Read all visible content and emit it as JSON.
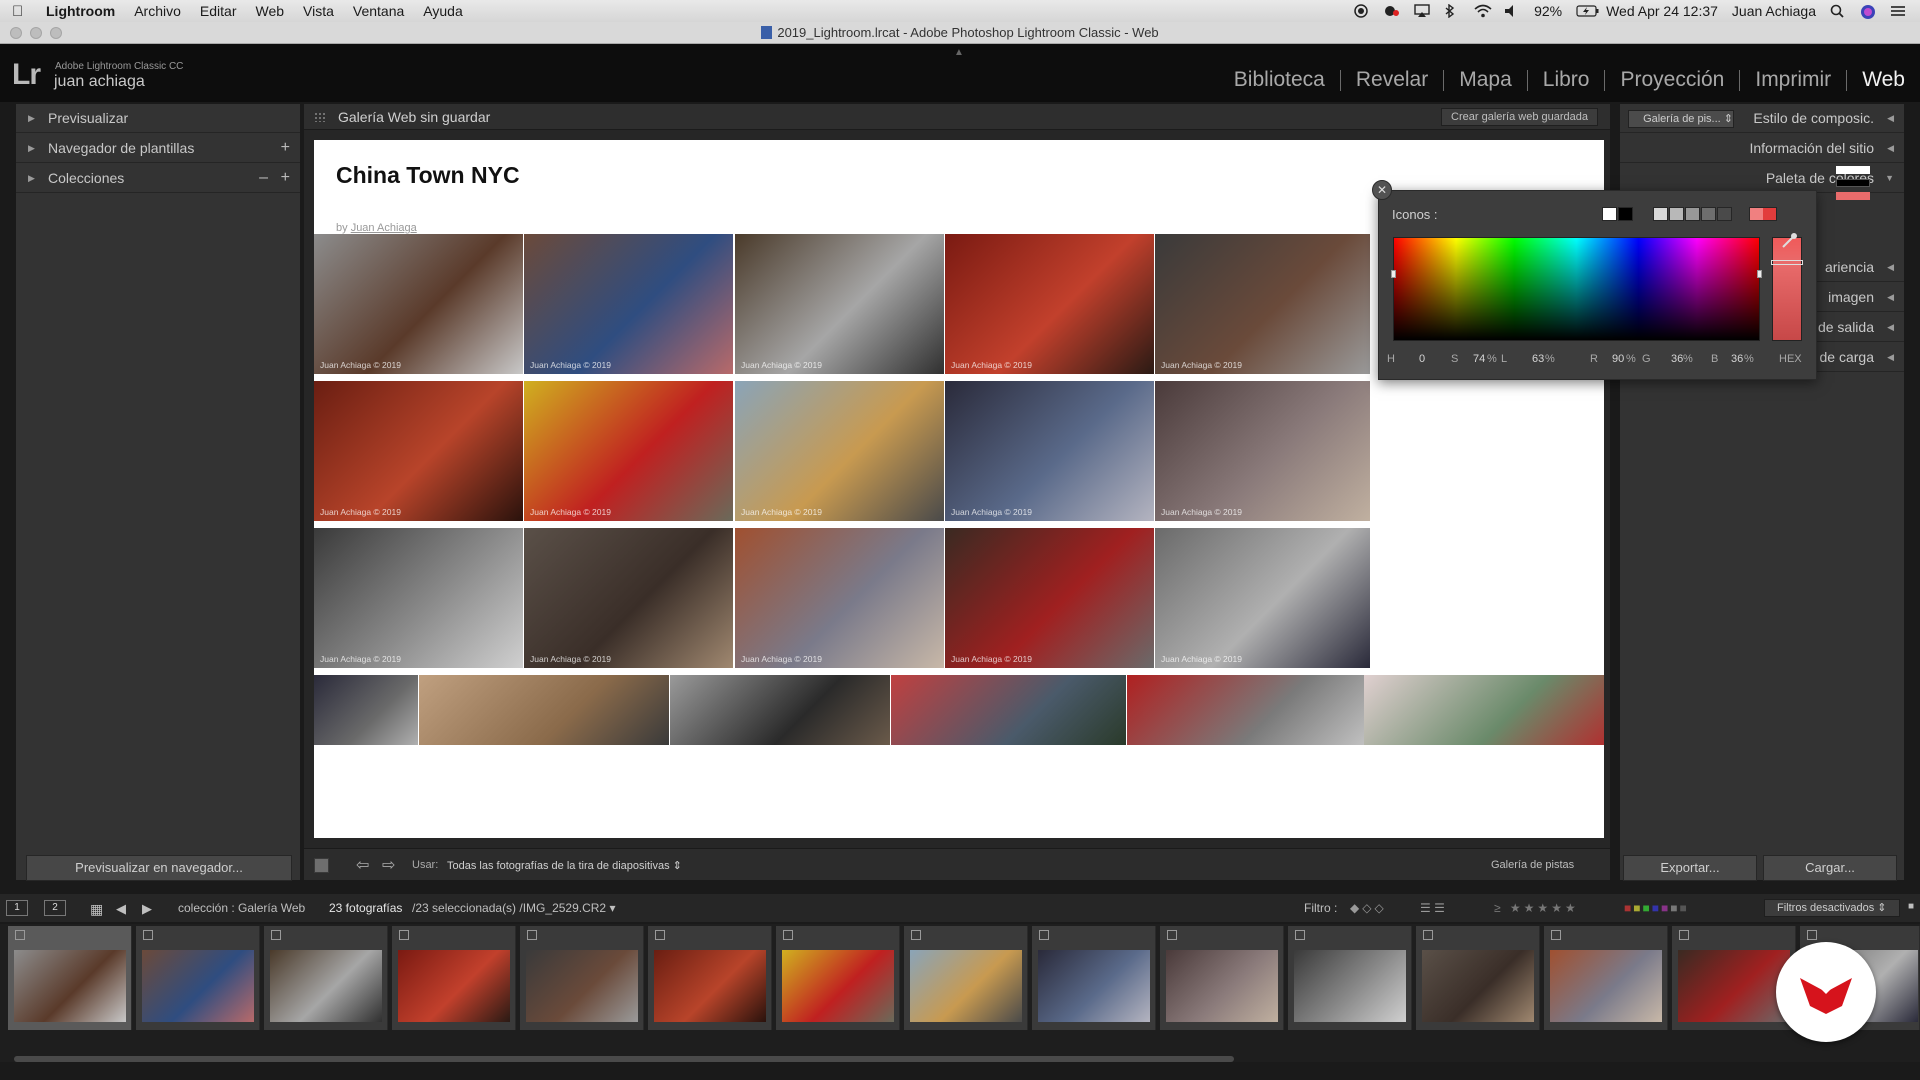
{
  "menubar": {
    "app": "Lightroom",
    "items": [
      "Archivo",
      "Editar",
      "Web",
      "Vista",
      "Ventana",
      "Ayuda"
    ],
    "battery": "92%",
    "datetime": "Wed Apr 24  12:37",
    "user": "Juan Achiaga"
  },
  "window": {
    "title": "2019_Lightroom.lrcat - Adobe Photoshop Lightroom Classic - Web"
  },
  "identity": {
    "logo": "Lr",
    "product": "Adobe Lightroom Classic CC",
    "user": "juan achiaga",
    "modules": [
      "Biblioteca",
      "Revelar",
      "Mapa",
      "Libro",
      "Proyección",
      "Imprimir",
      "Web"
    ],
    "active_module": "Web"
  },
  "left_panel": {
    "sections": [
      "Previsualizar",
      "Navegador de plantillas",
      "Colecciones"
    ],
    "preview_button": "Previsualizar en navegador..."
  },
  "center": {
    "header_title": "Galería Web sin guardar",
    "create_button": "Crear galería web guardada",
    "gallery": {
      "title": "China Town NYC",
      "by_prefix": "by ",
      "author": "Juan Achiaga",
      "watermark": "Juan Achiaga © 2019"
    },
    "toolbar": {
      "use_label": "Usar:",
      "use_value": "Todas las fotografías de la tira de diapositivas",
      "template_name": "Galería de pistas"
    }
  },
  "color_picker": {
    "label": "Iconos :",
    "H_label": "H",
    "H": "0",
    "S_label": "S",
    "S": "74",
    "S_unit": "%",
    "L_label": "L",
    "L": "63",
    "L_unit": "%",
    "R_label": "R",
    "R": "90",
    "R_unit": "%",
    "G_label": "G",
    "G": "36",
    "G_unit": "%",
    "B_label": "B",
    "B": "36",
    "B_unit": "%",
    "hex_label": "HEX",
    "current_color": "#e96b6b"
  },
  "right_panel": {
    "template_select": "Galería de pis...",
    "sections": [
      "Estilo de composic.",
      "Información del sitio",
      "Paleta de colores",
      "ariencia",
      "imagen",
      "de salida",
      "de carga"
    ],
    "export_button": "Exportar...",
    "upload_button": "Cargar..."
  },
  "filmstrip_toolbar": {
    "screen1": "1",
    "screen2": "2",
    "source": "colección : Galería Web",
    "count": "23 fotografías",
    "selection": "/23 seleccionada(s) /IMG_2529.CR2",
    "filter_label": "Filtro :",
    "filter_value": "Filtros desactivados"
  },
  "colors": {
    "accent_red": "#e96b6b",
    "badge_red": "#d6131c",
    "panel_bg": "#333333"
  }
}
